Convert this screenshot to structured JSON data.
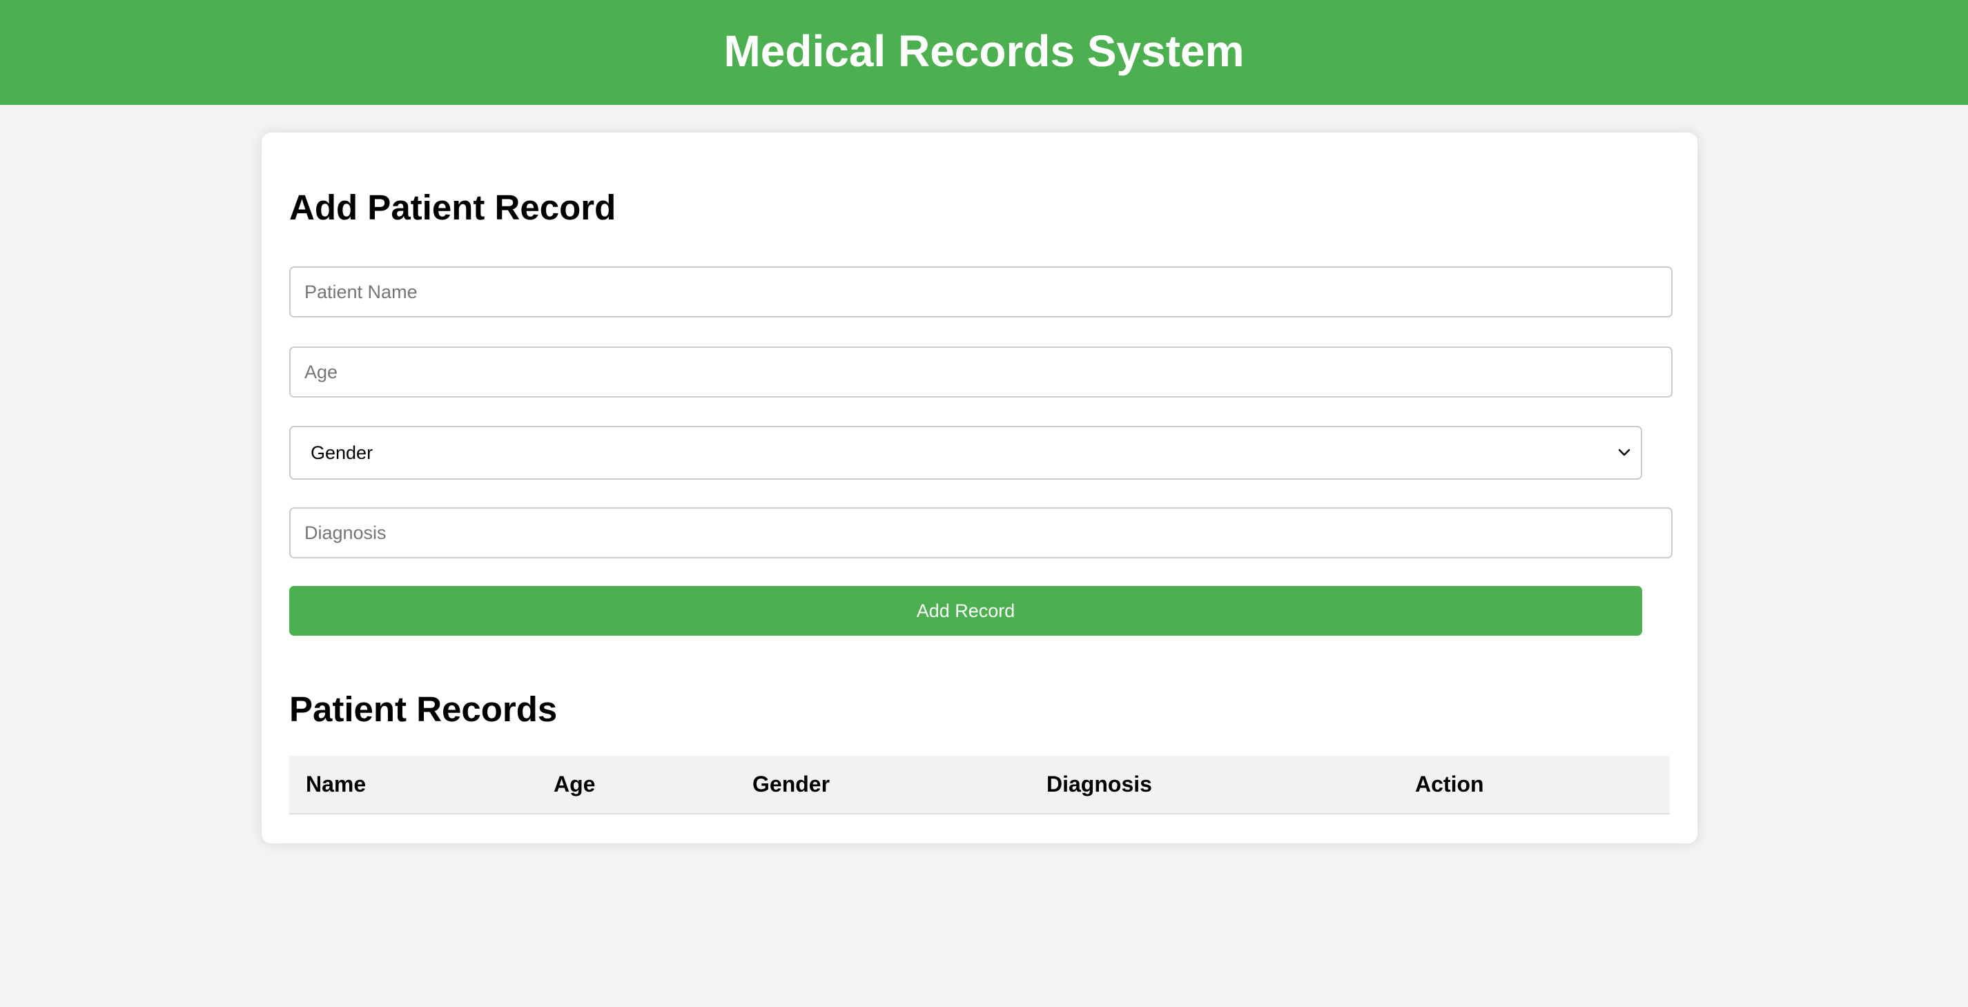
{
  "header": {
    "title": "Medical Records System"
  },
  "form": {
    "heading": "Add Patient Record",
    "patient_name": {
      "placeholder": "Patient Name",
      "value": ""
    },
    "age": {
      "placeholder": "Age",
      "value": ""
    },
    "gender": {
      "selected": "Gender"
    },
    "diagnosis": {
      "placeholder": "Diagnosis",
      "value": ""
    },
    "submit_label": "Add Record"
  },
  "records": {
    "heading": "Patient Records",
    "columns": [
      "Name",
      "Age",
      "Gender",
      "Diagnosis",
      "Action"
    ],
    "rows": []
  },
  "colors": {
    "accent": "#4caf50",
    "page_background": "#f4f4f4",
    "card_background": "#ffffff",
    "table_header_background": "#f2f2f2"
  }
}
